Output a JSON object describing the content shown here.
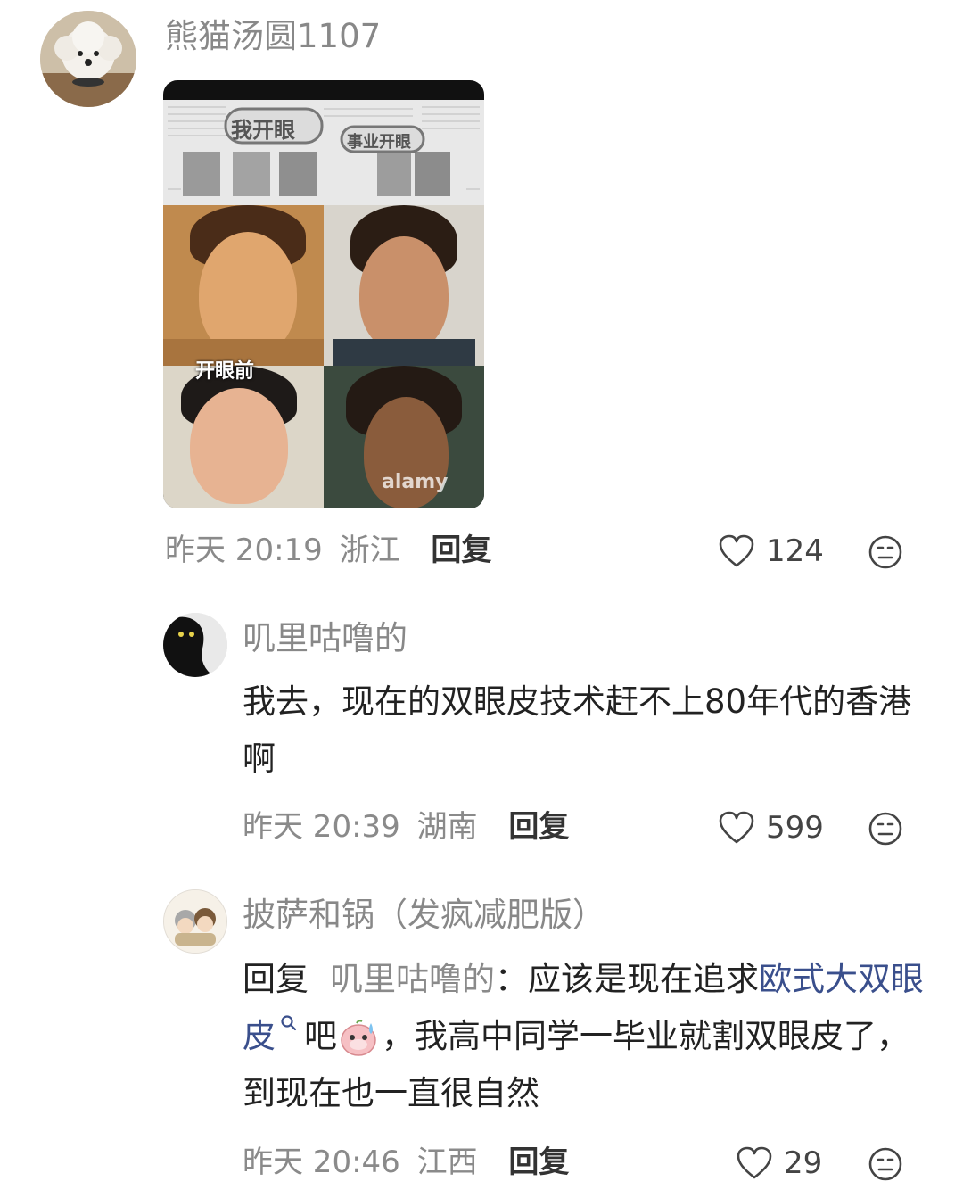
{
  "comments": [
    {
      "username": "熊猫汤圆1107",
      "image": {
        "overlay_title_left": "我开眼",
        "overlay_title_right": "事业开眼",
        "label_before": "开眼前",
        "watermark": "alamy"
      },
      "time": "昨天 20:19",
      "location": "浙江",
      "reply_label": "回复",
      "likes": "124"
    },
    {
      "username": "叽里咕噜的",
      "text": "我去，现在的双眼皮技术赶不上80年代的香港啊",
      "time": "昨天 20:39",
      "location": "湖南",
      "reply_label": "回复",
      "likes": "599"
    },
    {
      "username": "披萨和锅（发疯减肥版）",
      "text_prefix": "回复",
      "mention": "叽里咕噜的",
      "text_a": "：应该是现在追求",
      "link": "欧式大双眼皮",
      "text_b": "吧",
      "text_c": "，我高中同学一毕业就割双眼皮了，到现在也一直很自然",
      "time": "昨天 20:46",
      "location": "江西",
      "reply_label": "回复",
      "likes": "29"
    }
  ],
  "colors": {
    "meta": "#8a8a8a",
    "link": "#3a4f8c",
    "text": "#222222"
  },
  "icons": [
    "heart-outline-icon",
    "neutral-face-icon",
    "search-icon",
    "sweat-emoji-icon"
  ]
}
